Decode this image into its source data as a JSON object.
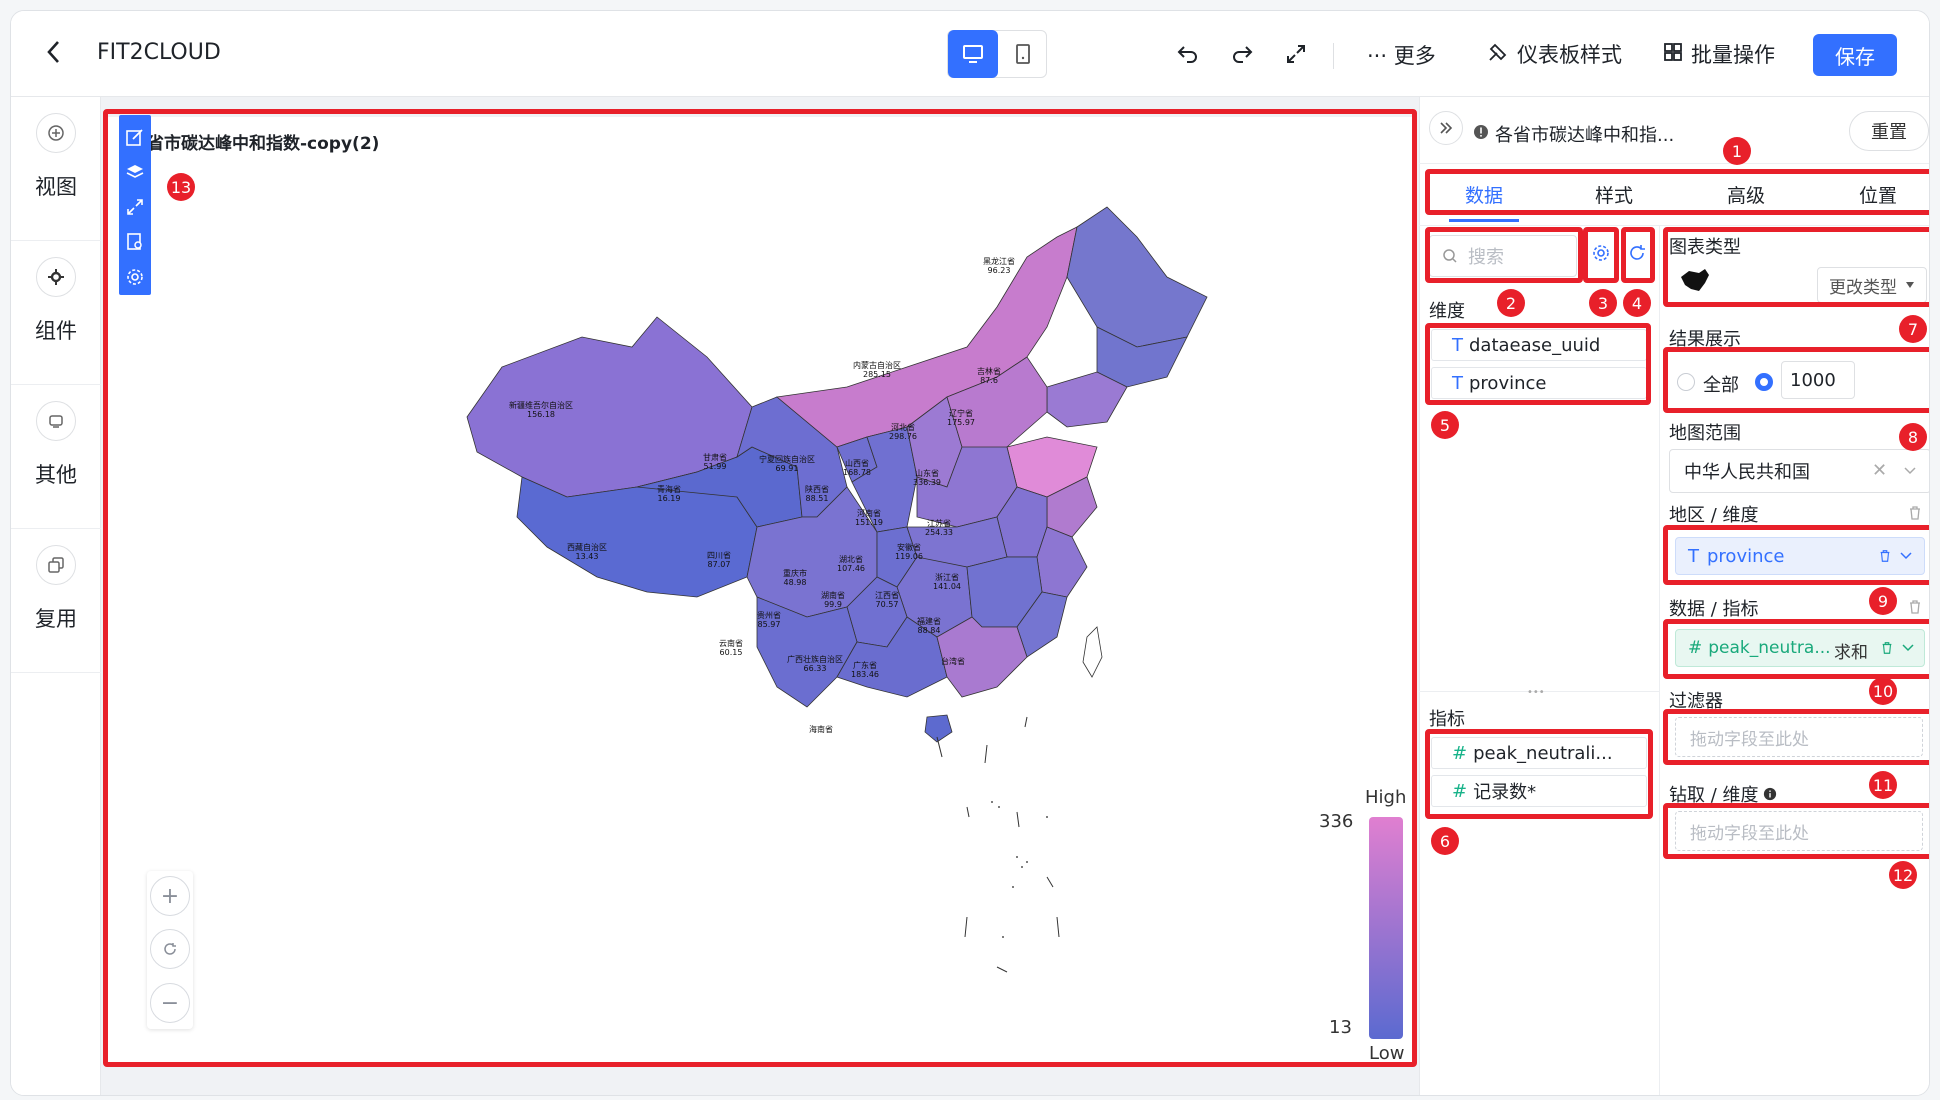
{
  "header": {
    "title": "FIT2CLOUD",
    "more_label": "··· 更多",
    "style_label": "仪表板样式",
    "batch_label": "批量操作",
    "save_label": "保存"
  },
  "sidebar": {
    "items": [
      {
        "label": "视图"
      },
      {
        "label": "组件"
      },
      {
        "label": "其他"
      },
      {
        "label": "复用"
      }
    ]
  },
  "chart": {
    "title": "省市碳达峰中和指数-copy(2)",
    "legend_high": "High",
    "legend_low": "Low",
    "legend_max": "336",
    "legend_min": "13",
    "zoom_in": "+",
    "zoom_out": "−",
    "provinces": [
      {
        "name": "黑龙江省",
        "value": "96.23"
      },
      {
        "name": "吉林省",
        "value": "87.6"
      },
      {
        "name": "辽宁省",
        "value": "175.97"
      },
      {
        "name": "内蒙古自治区",
        "value": "285.15"
      },
      {
        "name": "新疆维吾尔自治区",
        "value": "156.18"
      },
      {
        "name": "甘肃省",
        "value": "51.99"
      },
      {
        "name": "宁夏回族自治区",
        "value": "69.91"
      },
      {
        "name": "山西省",
        "value": "168.78"
      },
      {
        "name": "河北省",
        "value": "298.76"
      },
      {
        "name": "山东省",
        "value": "336.39"
      },
      {
        "name": "青海省",
        "value": "16.19"
      },
      {
        "name": "陕西省",
        "value": "88.51"
      },
      {
        "name": "河南省",
        "value": "151.19"
      },
      {
        "name": "江苏省",
        "value": "254.33"
      },
      {
        "name": "西藏自治区",
        "value": "13.43"
      },
      {
        "name": "四川省",
        "value": "87.07"
      },
      {
        "name": "湖北省",
        "value": "107.46"
      },
      {
        "name": "安徽省",
        "value": "119.06"
      },
      {
        "name": "重庆市",
        "value": "48.98"
      },
      {
        "name": "浙江省",
        "value": "141.04"
      },
      {
        "name": "湖南省",
        "value": "99.9"
      },
      {
        "name": "江西省",
        "value": "70.57"
      },
      {
        "name": "贵州省",
        "value": "85.97"
      },
      {
        "name": "福建省",
        "value": "88.84"
      },
      {
        "name": "云南省",
        "value": "60.15"
      },
      {
        "name": "广西壮族自治区",
        "value": "66.33"
      },
      {
        "name": "广东省",
        "value": "183.46"
      },
      {
        "name": "台湾省",
        "value": ""
      },
      {
        "name": "海南省",
        "value": ""
      }
    ]
  },
  "panel": {
    "chart_name": "各省市碳达峰中和指...",
    "reset_label": "重置",
    "tabs": [
      "数据",
      "样式",
      "高级",
      "位置"
    ],
    "search_placeholder": "搜索",
    "dimension_label": "维度",
    "dimensions": [
      "dataease_uuid",
      "province"
    ],
    "metric_label": "指标",
    "metrics": [
      "peak_neutrali...",
      "记录数*"
    ],
    "chart_type_label": "图表类型",
    "change_type_label": "更改类型",
    "result_label": "结果展示",
    "result_all": "全部",
    "result_count": "1000",
    "map_range_label": "地图范围",
    "map_range_value": "中华人民共和国",
    "region_label": "地区 / 维度",
    "region_field": "province",
    "data_label": "数据 / 指标",
    "data_field": "peak_neutra...",
    "data_agg": "求和",
    "filter_label": "过滤器",
    "filter_placeholder": "拖动字段至此处",
    "drill_label": "钻取 / 维度",
    "drill_placeholder": "拖动字段至此处"
  },
  "annotations": [
    "1",
    "2",
    "3",
    "4",
    "5",
    "6",
    "7",
    "8",
    "9",
    "10",
    "11",
    "12",
    "13"
  ],
  "colors": {
    "accent": "#3370ff",
    "annotation_red": "#e8202a",
    "map_low": "#5b6ad0",
    "map_high": "#e07fd0"
  }
}
